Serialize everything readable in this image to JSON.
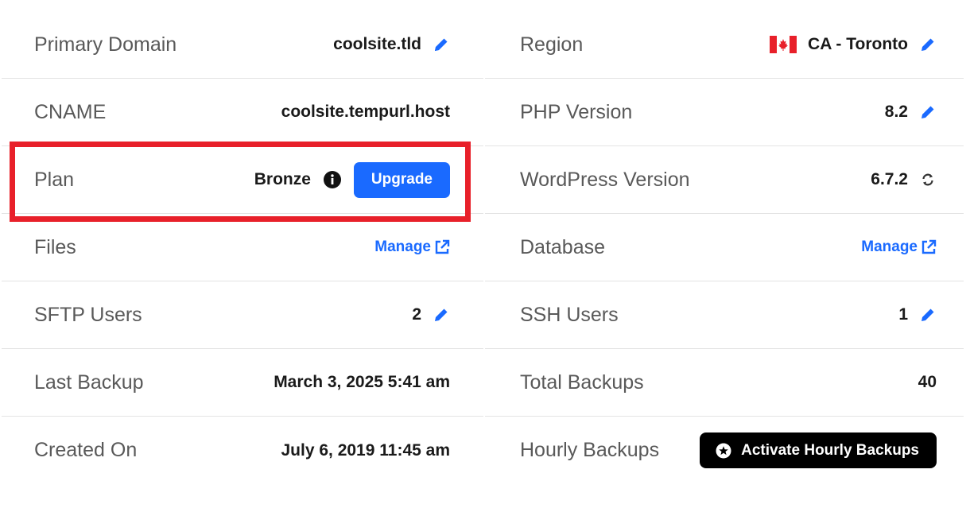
{
  "left": {
    "primary_domain": {
      "label": "Primary Domain",
      "value": "coolsite.tld"
    },
    "cname": {
      "label": "CNAME",
      "value": "coolsite.tempurl.host"
    },
    "plan": {
      "label": "Plan",
      "value": "Bronze",
      "upgrade_label": "Upgrade"
    },
    "files": {
      "label": "Files",
      "link": "Manage"
    },
    "sftp_users": {
      "label": "SFTP Users",
      "value": "2"
    },
    "last_backup": {
      "label": "Last Backup",
      "value": "March 3, 2025 5:41 am"
    },
    "created_on": {
      "label": "Created On",
      "value": "July 6, 2019 11:45 am"
    }
  },
  "right": {
    "region": {
      "label": "Region",
      "value": "CA - Toronto"
    },
    "php_version": {
      "label": "PHP Version",
      "value": "8.2"
    },
    "wordpress_version": {
      "label": "WordPress Version",
      "value": "6.7.2"
    },
    "database": {
      "label": "Database",
      "link": "Manage"
    },
    "ssh_users": {
      "label": "SSH Users",
      "value": "1"
    },
    "total_backups": {
      "label": "Total Backups",
      "value": "40"
    },
    "hourly_backups": {
      "label": "Hourly Backups",
      "button": "Activate Hourly Backups"
    }
  },
  "colors": {
    "accent": "#1a6aff",
    "highlight": "#e8202a",
    "label": "#595959",
    "value": "#1a1a1a"
  },
  "icons": [
    "pencil-icon",
    "info-icon",
    "external-link-icon",
    "refresh-icon",
    "star-icon",
    "canada-flag-icon"
  ]
}
